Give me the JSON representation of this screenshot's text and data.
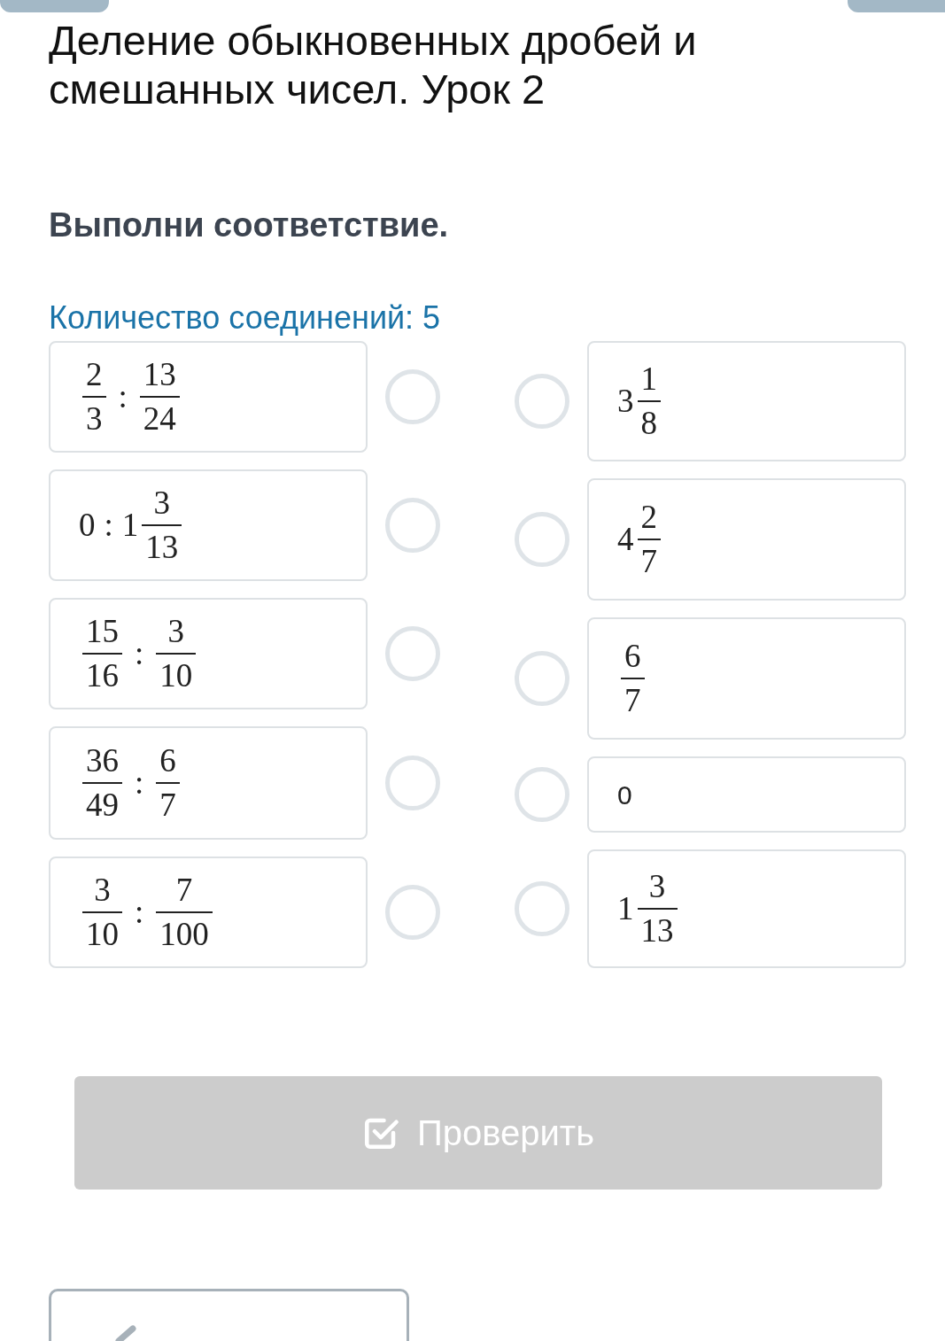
{
  "title": "Деление обыкновенных дробей и смешанных чисел. Урок 2",
  "instruction": "Выполни соответствие.",
  "connections_label": "Количество соединений: 5",
  "left_items": [
    {
      "selected": false,
      "terms": [
        {
          "kind": "fraction",
          "num": "2",
          "den": "3"
        },
        {
          "kind": "operator",
          "text": ":"
        },
        {
          "kind": "fraction",
          "num": "13",
          "den": "24"
        }
      ]
    },
    {
      "selected": false,
      "terms": [
        {
          "kind": "number",
          "text": "0"
        },
        {
          "kind": "operator",
          "text": ":"
        },
        {
          "kind": "mixed",
          "whole": "1",
          "num": "3",
          "den": "13"
        }
      ]
    },
    {
      "selected": false,
      "terms": [
        {
          "kind": "fraction",
          "num": "15",
          "den": "16"
        },
        {
          "kind": "operator",
          "text": ":"
        },
        {
          "kind": "fraction",
          "num": "3",
          "den": "10"
        }
      ]
    },
    {
      "selected": false,
      "terms": [
        {
          "kind": "fraction",
          "num": "36",
          "den": "49"
        },
        {
          "kind": "operator",
          "text": ":"
        },
        {
          "kind": "fraction",
          "num": "6",
          "den": "7"
        }
      ]
    },
    {
      "selected": false,
      "terms": [
        {
          "kind": "fraction",
          "num": "3",
          "den": "10"
        },
        {
          "kind": "operator",
          "text": ":"
        },
        {
          "kind": "fraction",
          "num": "7",
          "den": "100"
        }
      ]
    }
  ],
  "right_items": [
    {
      "selected": false,
      "terms": [
        {
          "kind": "mixed",
          "whole": "3",
          "num": "1",
          "den": "8"
        }
      ]
    },
    {
      "selected": false,
      "terms": [
        {
          "kind": "mixed",
          "whole": "4",
          "num": "2",
          "den": "7"
        }
      ]
    },
    {
      "selected": false,
      "terms": [
        {
          "kind": "fraction",
          "num": "6",
          "den": "7"
        }
      ]
    },
    {
      "selected": false,
      "terms": [
        {
          "kind": "text",
          "text": "0"
        }
      ]
    },
    {
      "selected": false,
      "terms": [
        {
          "kind": "mixed",
          "whole": "1",
          "num": "3",
          "den": "13"
        }
      ]
    }
  ],
  "check_button": {
    "label": "Проверить",
    "disabled": true
  }
}
